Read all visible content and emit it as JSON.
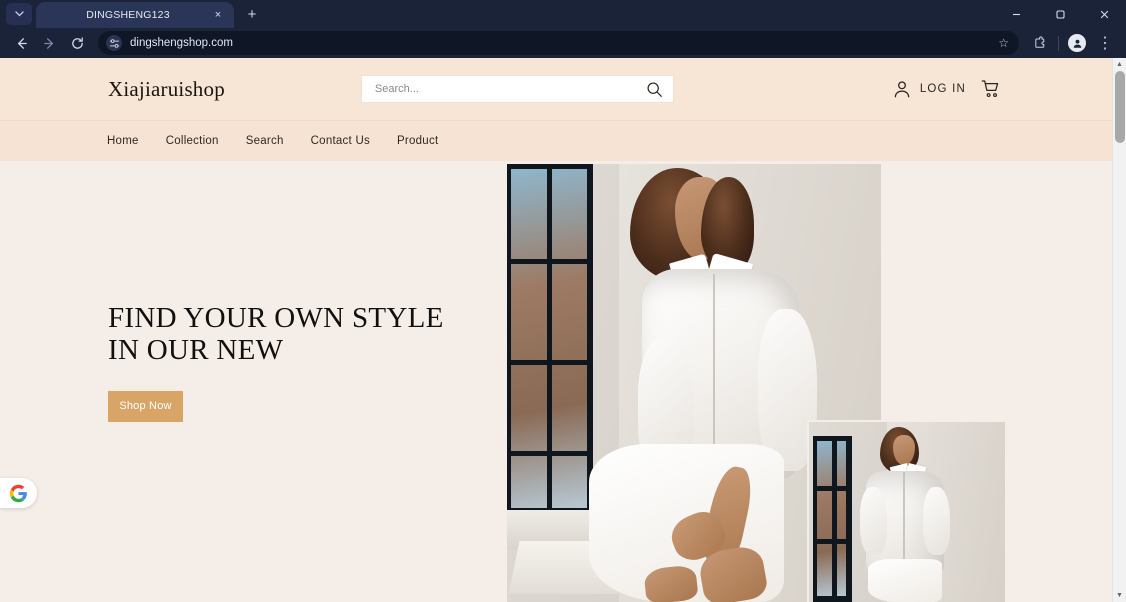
{
  "browser": {
    "tab": {
      "title": "DINGSHENG123",
      "close_label": "×"
    },
    "tab_search_label": "⌄",
    "new_tab_label": "+",
    "window_controls": {
      "minimize": "–",
      "maximize": "⬜",
      "close": "×"
    },
    "nav": {
      "back": "←",
      "forward": "→",
      "reload": "↻"
    },
    "omnibox": {
      "url": "dingshengshop.com",
      "site_icon": "tune-icon",
      "star": "☆"
    },
    "toolbar": {
      "extensions": "extensions-icon",
      "profile": "profile-avatar-icon",
      "menu": "⋮"
    }
  },
  "site": {
    "logo": "Xiajiaruishop",
    "search": {
      "placeholder": "Search...",
      "value": "",
      "icon": "search-icon"
    },
    "account": {
      "label": "LOG IN",
      "icon": "person-icon"
    },
    "cart": {
      "icon": "cart-icon"
    },
    "nav_items": [
      {
        "label": "Home"
      },
      {
        "label": "Collection"
      },
      {
        "label": "Search"
      },
      {
        "label": "Contact Us"
      },
      {
        "label": "Product"
      }
    ],
    "hero": {
      "title": "FIND YOUR OWN STYLE IN OUR NEW",
      "cta_label": "Shop Now",
      "main_image_alt": "woman in white shirt dress seated by a window",
      "sub_image_alt": "woman in white oversized shirt standing by a window"
    }
  },
  "overlays": {
    "google_badge": "google-g-icon"
  },
  "scrollbar": {
    "up_arrow": "▲",
    "down_arrow": "▼"
  },
  "colors": {
    "chrome": "#1b2338",
    "header_band": "#F7E5D6",
    "nav_band": "#F6E3D3",
    "page_bg": "#F5EDE8",
    "cta": "#D9A567",
    "text": "#2c2620"
  }
}
